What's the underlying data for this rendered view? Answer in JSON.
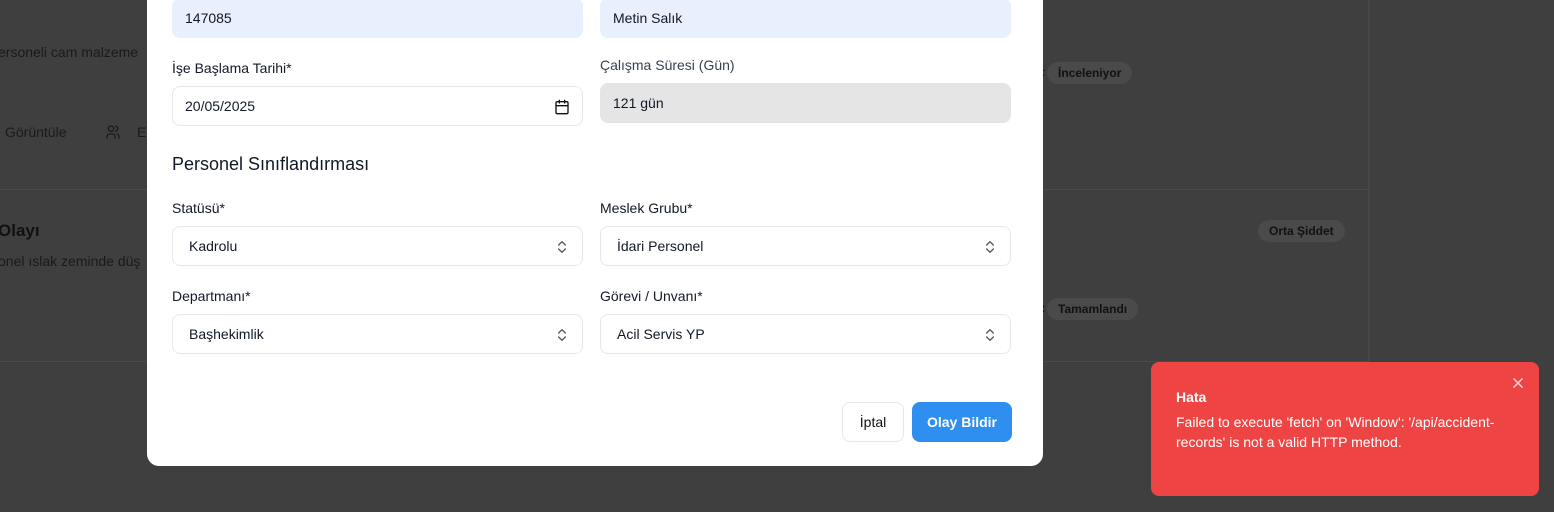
{
  "background": {
    "card1_desc": "ersoneli cam malzeme",
    "view_label": "Görüntüle",
    "edit_label": "E",
    "status_badge_1": "İnceleniyor",
    "card2_title": "Olayı",
    "card2_desc": "onel ıslak zeminde düş",
    "severity_badge": "Orta Şiddet",
    "status_badge_2": "Tamamlandı",
    "colon": ":"
  },
  "modal": {
    "sicil_no_value": "147085",
    "name_value": "Metin Salık",
    "start_date_label": "İşe Başlama Tarihi*",
    "start_date_value": "20/05/2025",
    "work_duration_label": "Çalışma Süresi (Gün)",
    "work_duration_value": "121 gün",
    "section_title": "Personel Sınıflandırması",
    "status_label": "Statüsü*",
    "status_value": "Kadrolu",
    "occupation_label": "Meslek Grubu*",
    "occupation_value": "İdari Personel",
    "department_label": "Departmanı*",
    "department_value": "Başhekimlik",
    "position_label": "Görevi / Unvanı*",
    "position_value": "Acil Servis YP",
    "cancel_label": "İptal",
    "submit_label": "Olay Bildir"
  },
  "toast": {
    "title": "Hata",
    "message": "Failed to execute 'fetch' on 'Window': '/api/accident-records' is not a valid HTTP method."
  },
  "colors": {
    "overlay": "#3f3f3f",
    "primary": "#2f8ff0",
    "error": "#ef4444"
  }
}
